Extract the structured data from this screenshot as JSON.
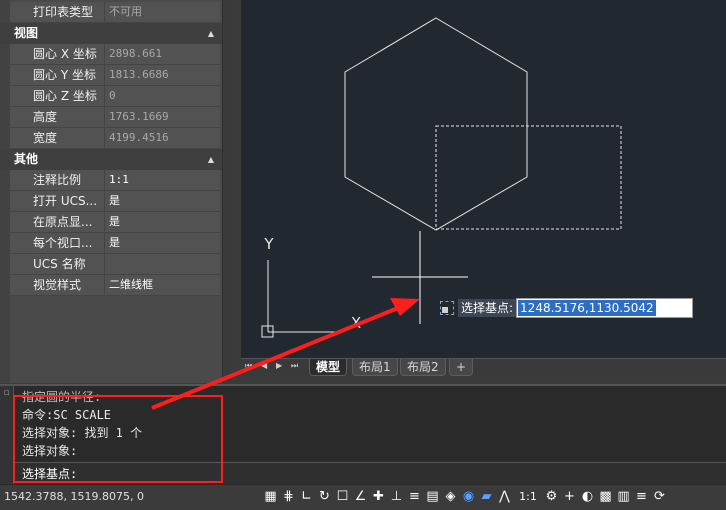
{
  "palette": {
    "rows_top": [
      {
        "label": "打印表类型",
        "value": "不可用",
        "dim": true
      }
    ],
    "categories": [
      {
        "title": "视图",
        "rows": [
          {
            "label": "圆心 X 坐标",
            "value": "2898.661",
            "dim": true
          },
          {
            "label": "圆心 Y 坐标",
            "value": "1813.6686",
            "dim": true
          },
          {
            "label": "圆心 Z 坐标",
            "value": "0",
            "dim": true
          },
          {
            "label": "高度",
            "value": "1763.1669",
            "dim": true
          },
          {
            "label": "宽度",
            "value": "4199.4516",
            "dim": true
          }
        ]
      },
      {
        "title": "其他",
        "rows": [
          {
            "label": "注释比例",
            "value": "1:1",
            "dim": false
          },
          {
            "label": "打开 UCS...",
            "value": "是",
            "dim": false
          },
          {
            "label": "在原点显...",
            "value": "是",
            "dim": false
          },
          {
            "label": "每个视口...",
            "value": "是",
            "dim": false
          },
          {
            "label": "UCS 名称",
            "value": "",
            "dim": false
          },
          {
            "label": "视觉样式",
            "value": "二维线框",
            "dim": false
          }
        ]
      }
    ]
  },
  "drawing": {
    "ucs_y_label": "Y",
    "ucs_x_label": "X",
    "dynamic_input": {
      "prompt": "选择基点:",
      "value": "1248.5176,1130.5042"
    }
  },
  "tabs": {
    "nav": [
      "⏮",
      "◀",
      "▶",
      "⏭"
    ],
    "items": [
      {
        "label": "模型",
        "active": true
      },
      {
        "label": "布局1",
        "active": false
      },
      {
        "label": "布局2",
        "active": false
      },
      {
        "label": "+",
        "active": false
      }
    ]
  },
  "command": {
    "history": [
      "指定圆的半径:",
      "命令:SC SCALE",
      "选择对象: 找到 1 个",
      "选择对象:"
    ],
    "current_prompt": "选择基点:"
  },
  "status": {
    "coords": "1542.3788, 1519.8075, 0",
    "annotation_scale": "1:1",
    "icons": [
      "grid-icon",
      "snap-icon",
      "ortho-icon",
      "polar-icon",
      "osnap-icon",
      "otrack-icon",
      "ducs-icon",
      "dyn-icon",
      "lineweight-icon",
      "transparency-icon",
      "selection-cycling-icon",
      "3d-osnap-icon",
      "dynamic-ucs-icon",
      "annotation-visibility-icon",
      "annotation-scale-icon",
      "workspace-icon",
      "annotation-monitor-icon",
      "units-icon",
      "isolate-objects-icon",
      "hardware-accel-icon",
      "clean-screen-icon",
      "customize-icon"
    ]
  },
  "colors": {
    "canvas": "#212830",
    "annotation_red": "#ff1e1e",
    "highlight_blue": "#2d6dc2"
  }
}
